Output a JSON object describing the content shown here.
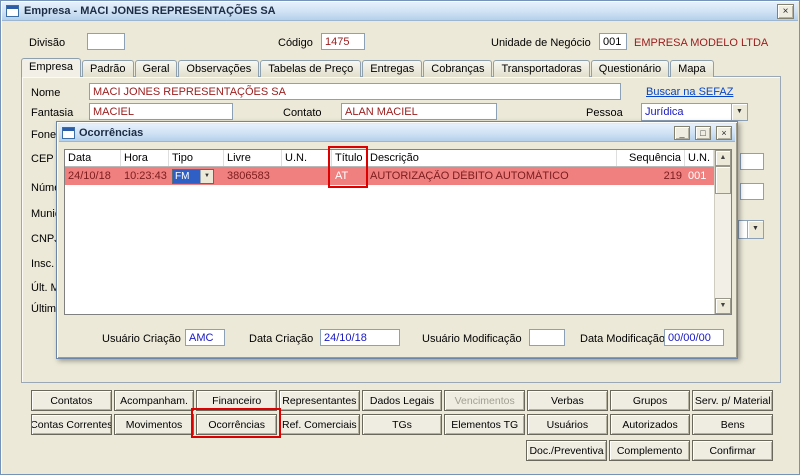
{
  "window": {
    "title": "Empresa - MACI JONES REPRESENTAÇÕES SA"
  },
  "icons": {
    "close": "×",
    "minimize": "_",
    "maximize": "□",
    "combo_arrow": "▼",
    "arrow_up": "▲",
    "arrow_down": "▼"
  },
  "header": {
    "divisao_label": "Divisão",
    "divisao_value": "",
    "codigo_label": "Código",
    "codigo_value": "1475",
    "unidade_label": "Unidade de Negócio",
    "unidade_code": "001",
    "unidade_name": "EMPRESA MODELO LTDA"
  },
  "tabs": [
    "Empresa",
    "Padrão",
    "Geral",
    "Observações",
    "Tabelas de Preço",
    "Entregas",
    "Cobranças",
    "Transportadoras",
    "Questionário",
    "Mapa"
  ],
  "form": {
    "nome_label": "Nome",
    "nome_value": "MACI JONES REPRESENTAÇÕES SA",
    "sefaz_link": "Buscar na SEFAZ",
    "fantasia_label": "Fantasia",
    "fantasia_value": "MACIEL",
    "contato_label": "Contato",
    "contato_value": "ALAN MACIEL",
    "pessoa_label": "Pessoa",
    "pessoa_value": "Jurídica",
    "fone_label": "Fone",
    "cep_label": "CEP",
    "numero_label": "Núme",
    "municipio_label": "Munic",
    "cnpj_label": "CNPJ",
    "insc_label": "Insc.",
    "ult_label": "Últ. M",
    "ultima_label": "Última"
  },
  "dialog": {
    "title": "Ocorrências",
    "columns": [
      "Data",
      "Hora",
      "Tipo",
      "Livre",
      "U.N.",
      "Título",
      "Descrição",
      "Sequência",
      "U.N."
    ],
    "row": {
      "data": "24/10/18",
      "hora": "10:23:43",
      "tipo": "FM",
      "livre": "3806583",
      "un1": "",
      "titulo": "AT",
      "descricao": "AUTORIZAÇÃO DÉBITO AUTOMÁTICO",
      "sequencia": "219",
      "un2": "001"
    },
    "footer": {
      "usuario_criacao_label": "Usuário Criação",
      "usuario_criacao_value": "AMC",
      "data_criacao_label": "Data Criação",
      "data_criacao_value": "24/10/18",
      "usuario_modificacao_label": "Usuário Modificação",
      "usuario_modificacao_value": "",
      "data_modificacao_label": "Data Modificação",
      "data_modificacao_value": "00/00/00"
    }
  },
  "buttons": {
    "row1": [
      "Contatos",
      "Acompanham.",
      "Financeiro",
      "Representantes",
      "Dados Legais",
      "Vencimentos",
      "Verbas",
      "Grupos",
      "Serv. p/ Material"
    ],
    "row2": [
      "Contas Correntes",
      "Movimentos",
      "Ocorrências",
      "Ref. Comerciais",
      "TGs",
      "Elementos TG",
      "Usuários",
      "Autorizados",
      "Bens"
    ],
    "row3": [
      "Doc./Preventiva",
      "Complemento",
      "Confirmar"
    ]
  },
  "colors": {
    "highlight_row": "#f08080",
    "annotation": "#dd0000",
    "value_red": "#9b1b1b",
    "value_blue": "#1919c0"
  }
}
